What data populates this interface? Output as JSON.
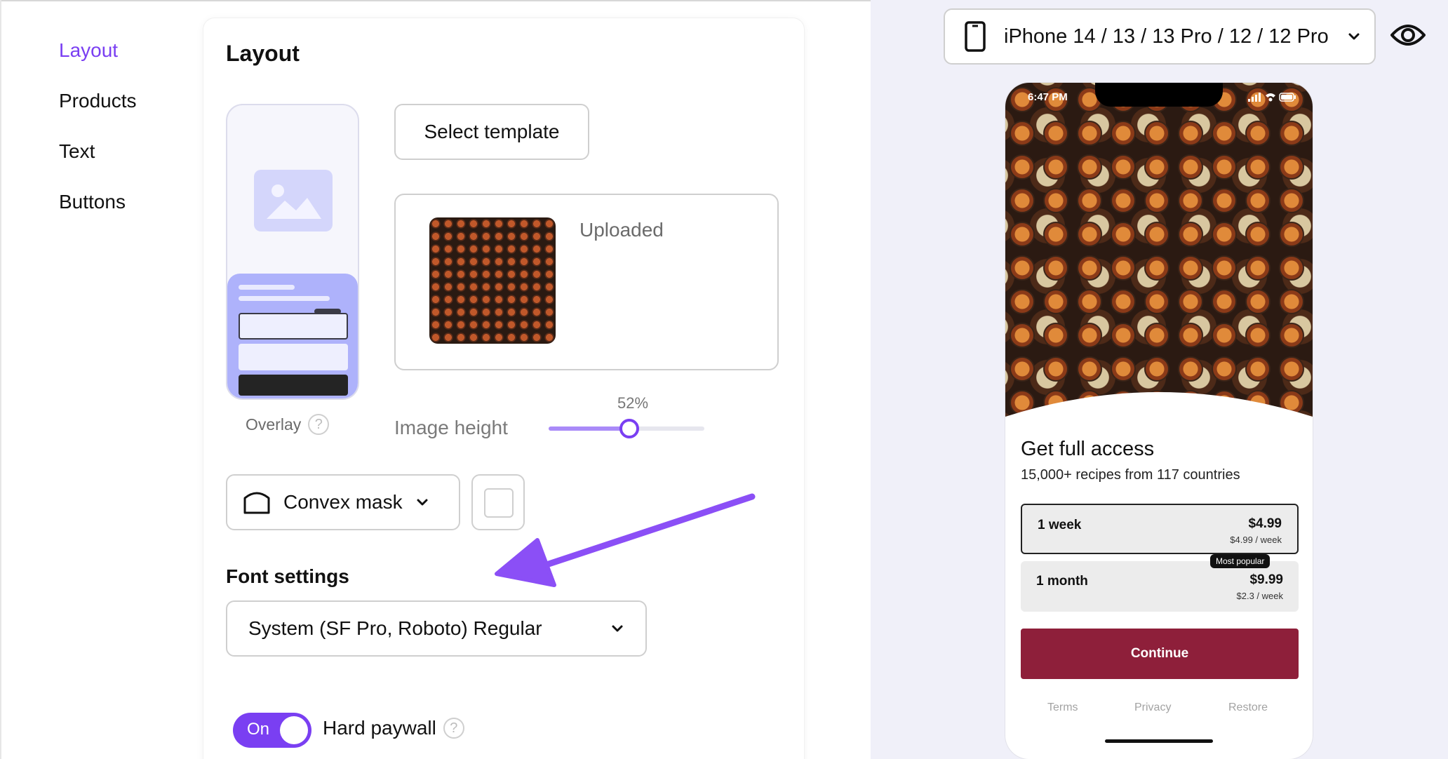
{
  "nav": {
    "items": [
      {
        "label": "Layout",
        "active": true
      },
      {
        "label": "Products",
        "active": false
      },
      {
        "label": "Text",
        "active": false
      },
      {
        "label": "Buttons",
        "active": false
      }
    ]
  },
  "card": {
    "title": "Layout",
    "overlay_label": "Overlay",
    "help_glyph": "?",
    "select_template_label": "Select template",
    "upload_status": "Uploaded",
    "image_height": {
      "label": "Image height",
      "value_text": "52%",
      "value": 0.52
    },
    "mask": {
      "label": "Convex mask"
    },
    "font_settings_label": "Font settings",
    "font_select": {
      "value": "System (SF Pro, Roboto) Regular"
    },
    "toggle": {
      "label": "On",
      "on": true
    },
    "hard_paywall_label": "Hard paywall"
  },
  "preview": {
    "device_label": "iPhone 14 / 13 / 13 Pro / 12 / 12 Pro",
    "phone": {
      "status_time": "6:47 PM",
      "title": "Get full access",
      "subtitle": "15,000+ recipes from 117 countries",
      "plans": [
        {
          "name": "1 week",
          "price": "$4.99",
          "per_week": "$4.99 / week",
          "selected": true
        },
        {
          "name": "1 month",
          "price": "$9.99",
          "per_week": "$2.3 / week",
          "selected": false,
          "badge": "Most popular"
        }
      ],
      "continue_label": "Continue",
      "continue_color": "#8e1f3a",
      "footer": [
        "Terms",
        "Privacy",
        "Restore"
      ]
    }
  },
  "colors": {
    "accent": "#7a3ff2",
    "slider_fill": "#a98af8",
    "overlay_thumb": "#aeb2fb"
  }
}
